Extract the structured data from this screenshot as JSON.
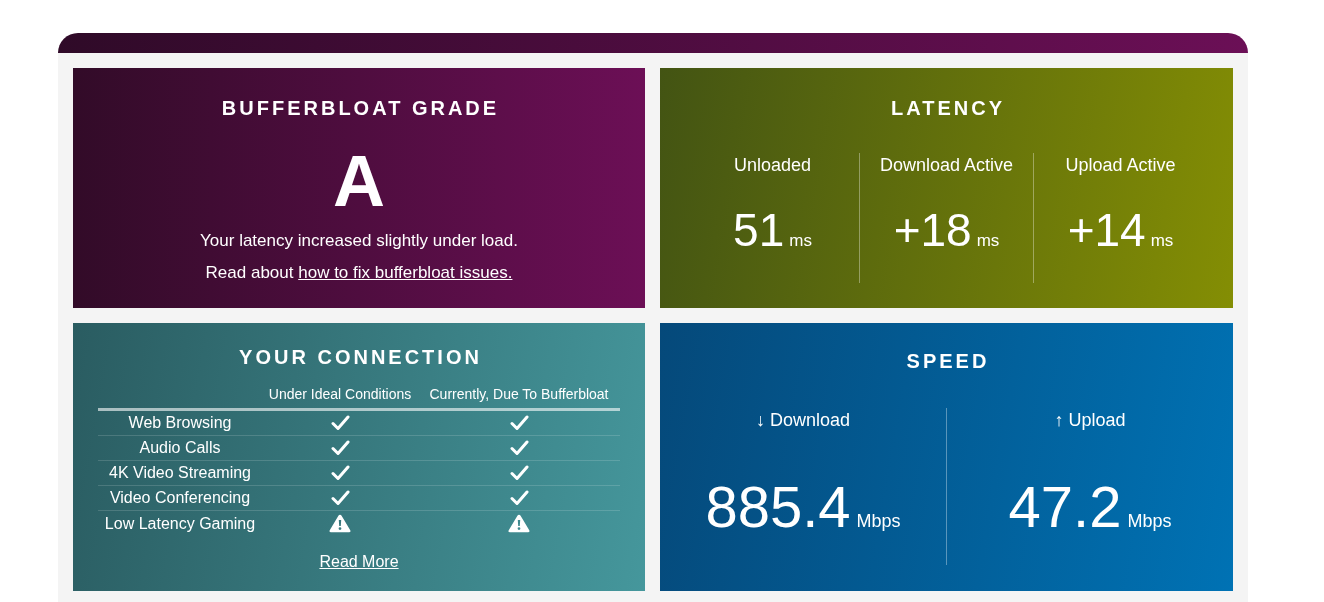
{
  "grade_card": {
    "title": "BUFFERBLOAT GRADE",
    "grade": "A",
    "message": "Your latency increased slightly under load.",
    "link_prefix": "Read about ",
    "link": "how to fix bufferbloat issues."
  },
  "latency": {
    "title": "LATENCY",
    "metrics": [
      {
        "label": "Unloaded",
        "value": "51",
        "unit": "ms"
      },
      {
        "label": "Download Active",
        "value": "+18",
        "unit": "ms"
      },
      {
        "label": "Upload Active",
        "value": "+14",
        "unit": "ms"
      }
    ]
  },
  "connection": {
    "title": "YOUR CONNECTION",
    "columns": [
      "Under Ideal Conditions",
      "Currently, Due To Bufferbloat"
    ],
    "rows": [
      {
        "label": "Web Browsing",
        "ideal_ok": true,
        "current_ok": true
      },
      {
        "label": "Audio Calls",
        "ideal_ok": true,
        "current_ok": true
      },
      {
        "label": "4K Video Streaming",
        "ideal_ok": true,
        "current_ok": true
      },
      {
        "label": "Video Conferencing",
        "ideal_ok": true,
        "current_ok": true
      },
      {
        "label": "Low Latency Gaming",
        "ideal_ok": false,
        "current_ok": false
      }
    ],
    "link": "Read More"
  },
  "speed": {
    "title": "SPEED",
    "metrics": [
      {
        "label": "↓ Download",
        "value": "885.4",
        "unit": "Mbps"
      },
      {
        "label": "↑ Upload",
        "value": "47.2",
        "unit": "Mbps"
      }
    ]
  }
}
